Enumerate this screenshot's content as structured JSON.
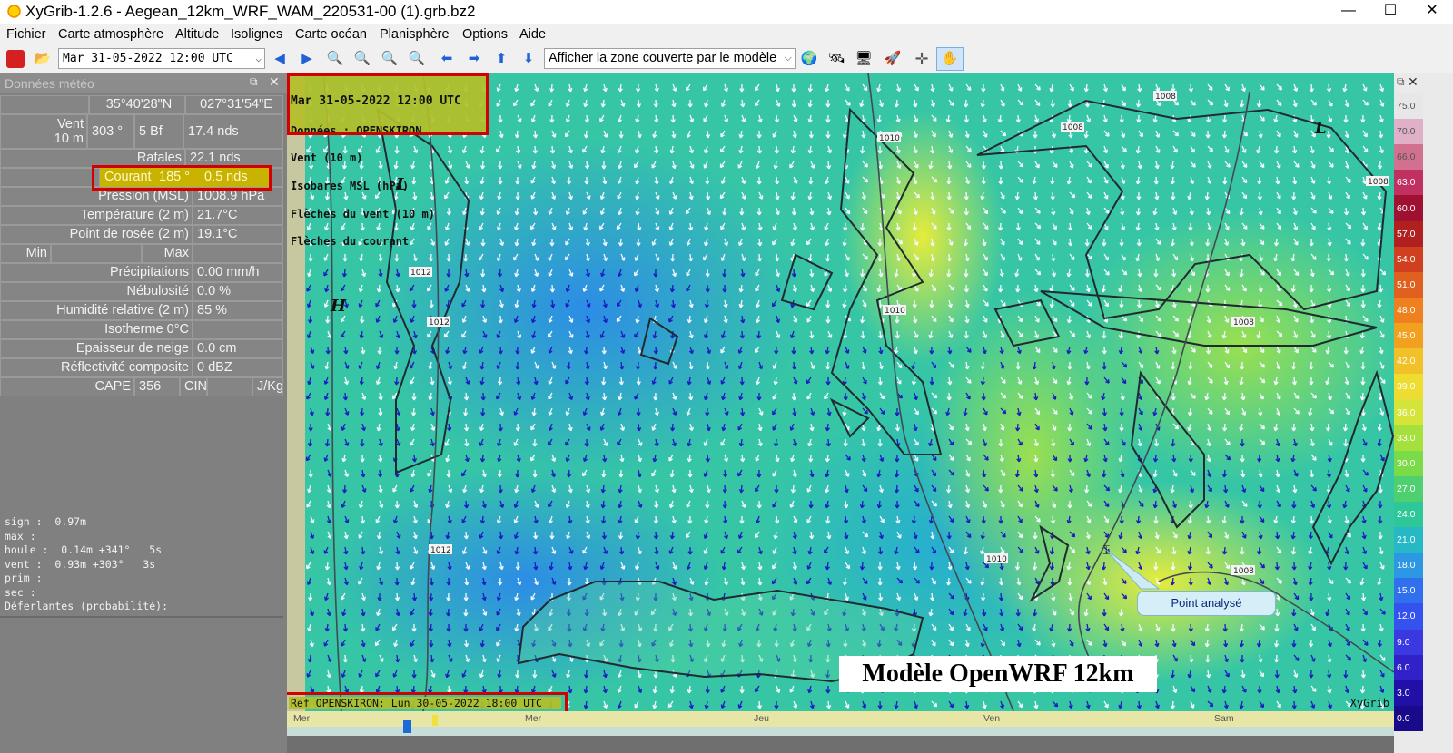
{
  "window": {
    "title": "XyGrib-1.2.6 - Aegean_12km_WRF_WAM_220531-00 (1).grb.bz2",
    "minimize": "—",
    "maximize": "☐",
    "close": "✕"
  },
  "menu": [
    "Fichier",
    "Carte atmosphère",
    "Altitude",
    "Isolignes",
    "Carte océan",
    "Planisphère",
    "Options",
    "Aide"
  ],
  "toolbar": {
    "date_value": "Mar 31-05-2022 12:00 UTC",
    "zone_value": "Afficher la zone couverte par le modèle"
  },
  "panel": {
    "title": "Données météo",
    "lat": "35°40'28\"N",
    "lon": "027°31'54\"E",
    "wind_label_1": "Vent",
    "wind_label_2": "10 m",
    "wind_dir": "303 °",
    "wind_bf": "5 Bf",
    "wind_speed": "17.4  nds",
    "gust_label": "Rafales",
    "gust_value": "22.1  nds",
    "current_label": "Courant",
    "current_dir": "185 °",
    "current_speed": "0.5  nds",
    "pressure_label": "Pression (MSL)",
    "pressure_value": "1008.9 hPa",
    "temp_label": "Température (2 m)",
    "temp_value": "21.7°C",
    "dew_label": "Point de rosée (2 m)",
    "dew_value": "19.1°C",
    "min_label": "Min",
    "max_label": "Max",
    "precip_label": "Précipitations",
    "precip_value": "0.00 mm/h",
    "cloud_label": "Nébulosité",
    "cloud_value": "0.0 %",
    "humid_label": "Humidité relative (2 m)",
    "humid_value": "85 %",
    "iso_label": "Isotherme 0°C",
    "snow_label": "Epaisseur de neige",
    "snow_value": "0.0 cm",
    "refl_label": "Réflectivité composite",
    "refl_value": "0 dBZ",
    "cape_label": "CAPE",
    "cape_value": "356",
    "cin_label": "CIN",
    "jkg_label": "J/Kg",
    "wave_lines": [
      "sign :  0.97m",
      "max :",
      "houle :  0.14m +341°   5s",
      "vent :  0.93m +303°   3s",
      "prim :",
      "sec :",
      "Déferlantes (probabilité):"
    ]
  },
  "map": {
    "info_lines": [
      "Mar 31-05-2022 12:00 UTC",
      "Données : OPENSKIRON",
      "Vent (10 m)",
      "Isobares MSL (hPa)",
      "Flèches du vent (10 m)",
      "Flèches du courant"
    ],
    "ref_text": "Ref OPENSKIRON: Lun 30-05-2022 18:00 UTC",
    "model_label": "Modèle OpenWRF 12km",
    "callout": "Point analysé",
    "watermark": "XyGrib",
    "isobars": [
      "1008",
      "1008",
      "1010",
      "1008",
      "1012",
      "1012",
      "1010",
      "1008",
      "1012",
      "1010",
      "1008"
    ],
    "pressure_marks": [
      "L",
      "H",
      "L"
    ]
  },
  "timeline": [
    "Mer",
    "Mer",
    "Jeu",
    "Ven",
    "Sam"
  ],
  "legend": {
    "ticks": [
      "75.0",
      "70.0",
      "66.0",
      "63.0",
      "60.0",
      "57.0",
      "54.0",
      "51.0",
      "48.0",
      "45.0",
      "42.0",
      "39.0",
      "36.0",
      "33.0",
      "30.0",
      "27.0",
      "24.0",
      "21.0",
      "18.0",
      "15.0",
      "12.0",
      "9.0",
      "6.0",
      "3.0",
      "0.0"
    ],
    "colors": [
      "#e7e7e7",
      "#e0b0c8",
      "#d27090",
      "#c03060",
      "#a01030",
      "#b02020",
      "#d04020",
      "#e06020",
      "#ee8020",
      "#f2a020",
      "#f2c028",
      "#eedc30",
      "#d4e438",
      "#a6e03c",
      "#7ada48",
      "#4ed070",
      "#2ec898",
      "#26b8c4",
      "#2c98e4",
      "#3070ee",
      "#3452ee",
      "#3a38e0",
      "#3022c8",
      "#2010a8",
      "#180a88"
    ]
  }
}
